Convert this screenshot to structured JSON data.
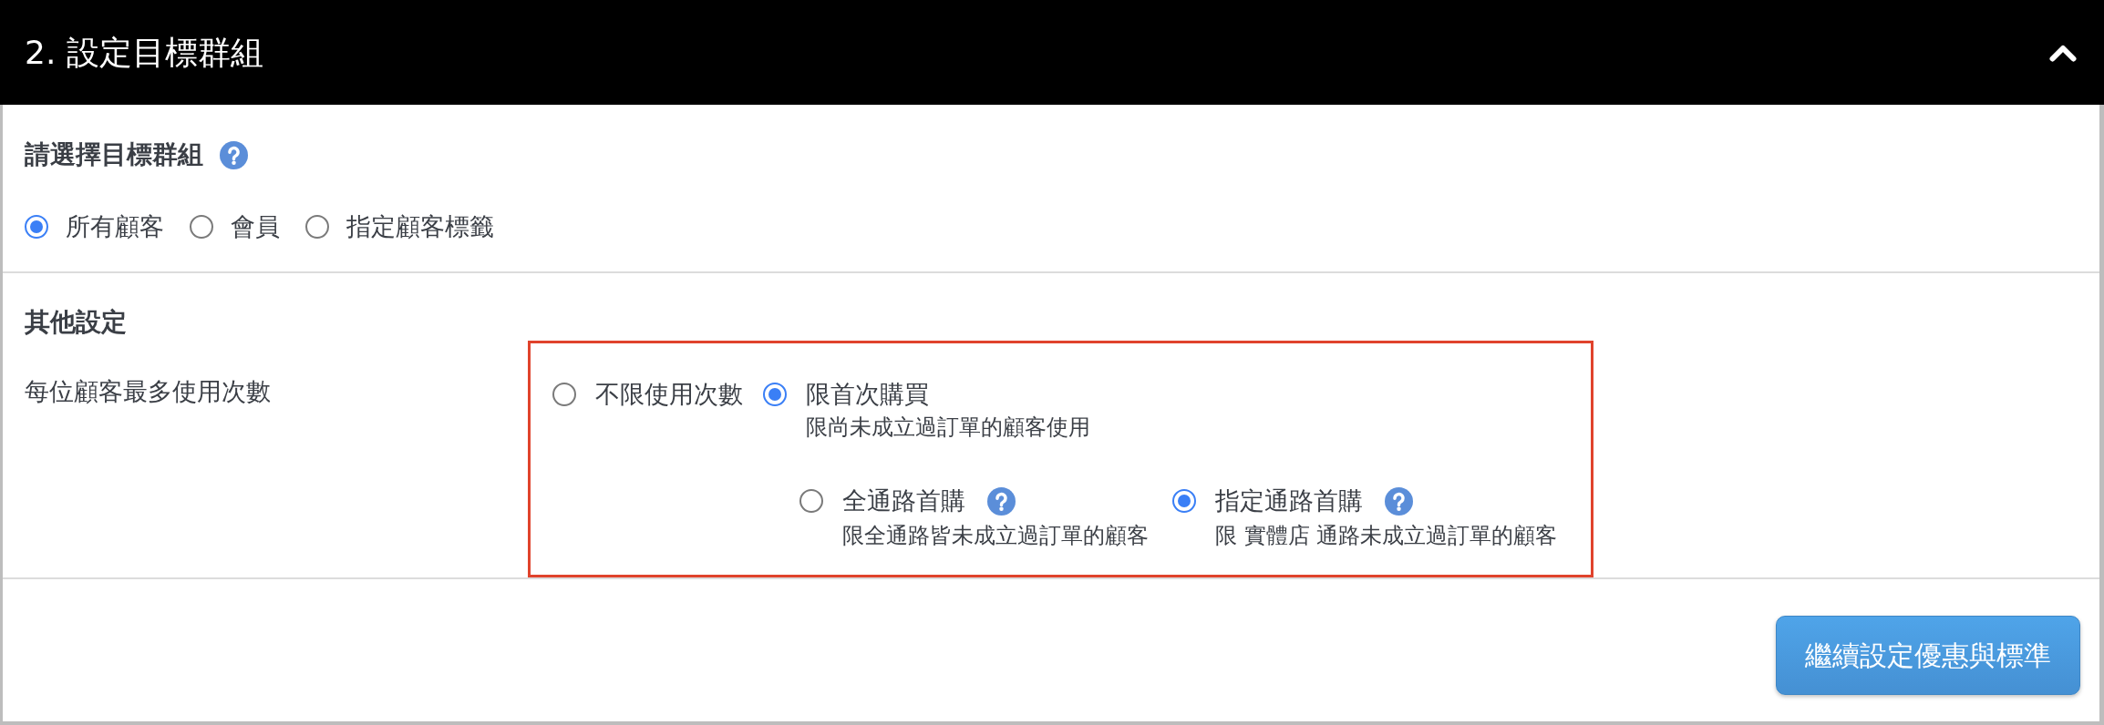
{
  "panel": {
    "title": "2. 設定目標群組",
    "expanded": true
  },
  "target_group": {
    "heading": "請選擇目標群組",
    "help": true,
    "options": [
      {
        "label": "所有顧客",
        "selected": true
      },
      {
        "label": "會員",
        "selected": false
      },
      {
        "label": "指定顧客標籤",
        "selected": false
      }
    ]
  },
  "other_settings": {
    "heading": "其他設定",
    "fields": [
      {
        "label": "每位顧客最多使用次數",
        "highlighted": true,
        "options": [
          {
            "label": "不限使用次數",
            "selected": false
          },
          {
            "label": "限首次購買",
            "selected": true,
            "description": "限尚未成立過訂單的顧客使用",
            "children": [
              {
                "label": "全通路首購",
                "selected": false,
                "help": true,
                "description": "限全通路皆未成立過訂單的顧客"
              },
              {
                "label": "指定通路首購",
                "selected": true,
                "help": true,
                "description": "限 實體店 通路未成立過訂單的顧客"
              }
            ]
          }
        ]
      }
    ]
  },
  "footer": {
    "button": "繼續設定優惠與標準"
  }
}
